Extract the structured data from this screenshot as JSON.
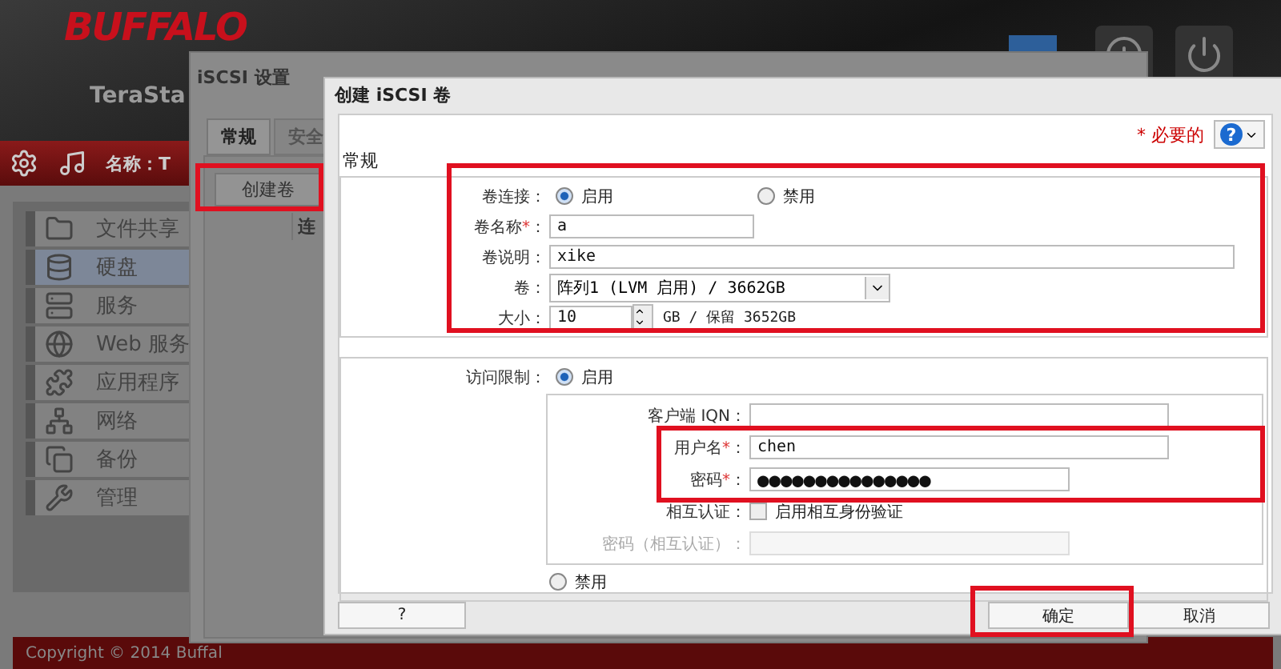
{
  "app": {
    "brand": "BUFFALO",
    "product": "TeraSta",
    "toolbar_label": "名称：T",
    "sidebar": [
      {
        "label": "文件共享",
        "selected": false
      },
      {
        "label": "硬盘",
        "selected": true
      },
      {
        "label": "服务",
        "selected": false
      },
      {
        "label": "Web 服务",
        "selected": false
      },
      {
        "label": "应用程序",
        "selected": false
      },
      {
        "label": "网络",
        "selected": false
      },
      {
        "label": "备份",
        "selected": false
      },
      {
        "label": "管理",
        "selected": false
      }
    ],
    "footer": "Copyright © 2014 Buffal"
  },
  "settings_dialog": {
    "title": "iSCSI 设置",
    "tabs": [
      {
        "label": "常规",
        "selected": true
      },
      {
        "label": "安全",
        "selected": false
      }
    ],
    "create_button": "创建卷",
    "column_1": "连"
  },
  "dialog": {
    "title": "创建 iSCSI 卷",
    "required_mark": "*",
    "required_note": "必要的",
    "help_label": "?",
    "colon": "：",
    "section": "常规",
    "volume_link": {
      "label": "卷连接",
      "options": [
        {
          "label": "启用",
          "selected": true
        },
        {
          "label": "禁用",
          "selected": false
        }
      ]
    },
    "name": {
      "label": "卷名称",
      "required": true,
      "value": "a"
    },
    "description": {
      "label": "卷说明",
      "value": "xike"
    },
    "volume": {
      "label": "卷",
      "value": "阵列1 (LVM 启用) / 3662GB"
    },
    "size": {
      "label": "大小",
      "value": "10",
      "suffix": "GB / 保留 3652GB"
    },
    "access": {
      "label": "访问限制",
      "options": [
        {
          "label": "启用",
          "selected": true
        },
        {
          "label": "禁用",
          "selected": false
        }
      ]
    },
    "iqn": {
      "label": "客户端 IQN"
    },
    "user": {
      "label": "用户名",
      "required": true,
      "value": "chen"
    },
    "password": {
      "label": "密码",
      "required": true,
      "value": "●●●●●●●●●●●●●●●"
    },
    "mutual": {
      "label": "相互认证",
      "checked": false,
      "text": "启用相互身份验证"
    },
    "mutual_password": {
      "label": "密码（相互认证）",
      "disabled": true
    },
    "buttons": {
      "help": "?",
      "ok": "确定",
      "cancel": "取消"
    }
  }
}
